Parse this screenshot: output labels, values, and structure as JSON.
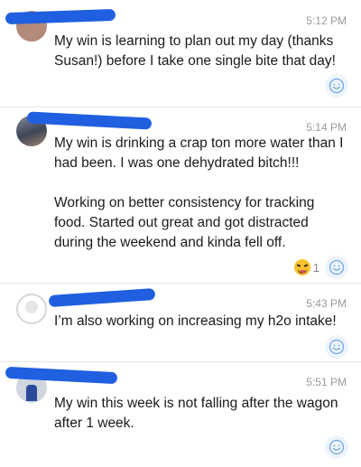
{
  "posts": [
    {
      "time": "5:12 PM",
      "text": "My win is learning to plan out my day (thanks Susan!) before I take one single bite that day!"
    },
    {
      "time": "5:14 PM",
      "text": "My win is drinking a crap ton more water than I had been. I was one dehydrated bitch!!!\n\nWorking on better consistency for tracking food. Started out great and got distracted during the weekend and kinda fell off.",
      "reaction_emoji": "squinting-face-with-tongue",
      "reaction_count": "1"
    },
    {
      "time": "5:43 PM",
      "text": "I’m also working on increasing my h2o intake!"
    },
    {
      "time": "5:51 PM",
      "text": "My win this week is not falling after the wagon after 1 week."
    }
  ],
  "colors": {
    "redaction": "#1f5fe0",
    "react_icon": "#6fa7e6"
  }
}
